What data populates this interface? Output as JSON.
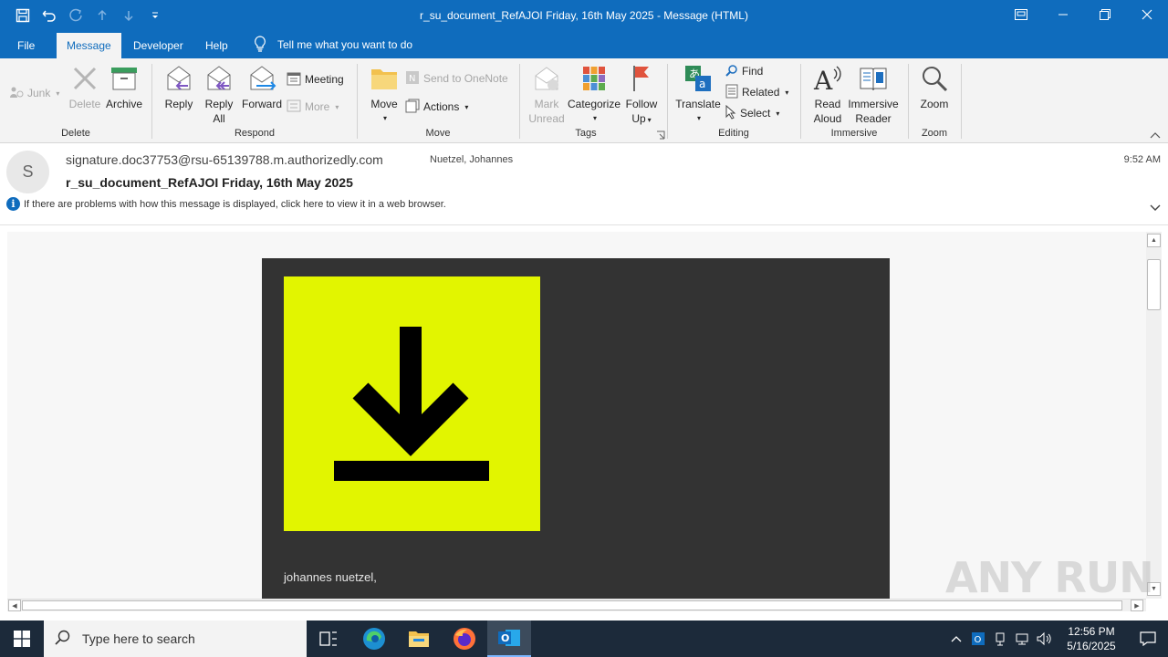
{
  "window": {
    "title": "r_su_document_RefAJOI Friday, 16th May 2025  -  Message (HTML)"
  },
  "tabs": [
    {
      "label": "File"
    },
    {
      "label": "Message"
    },
    {
      "label": "Developer"
    },
    {
      "label": "Help"
    }
  ],
  "tell_me": "Tell me what you want to do",
  "ribbon": {
    "delete": {
      "junk": "Junk",
      "delete": "Delete",
      "archive": "Archive",
      "label": "Delete"
    },
    "respond": {
      "reply": "Reply",
      "reply_all_1": "Reply",
      "reply_all_2": "All",
      "forward": "Forward",
      "meeting": "Meeting",
      "more": "More",
      "label": "Respond"
    },
    "move": {
      "move": "Move",
      "send_to_onenote": "Send to OneNote",
      "actions": "Actions",
      "label": "Move"
    },
    "tags": {
      "mark_unread_1": "Mark",
      "mark_unread_2": "Unread",
      "categorize": "Categorize",
      "follow_up_1": "Follow",
      "follow_up_2": "Up",
      "label": "Tags"
    },
    "editing": {
      "translate": "Translate",
      "find": "Find",
      "related": "Related",
      "select": "Select",
      "label": "Editing"
    },
    "immersive": {
      "read_aloud_1": "Read",
      "read_aloud_2": "Aloud",
      "immersive_reader_1": "Immersive",
      "immersive_reader_2": "Reader",
      "label": "Immersive"
    },
    "zoom": {
      "zoom": "Zoom",
      "label": "Zoom"
    }
  },
  "message": {
    "avatar_initial": "S",
    "from": "signature.doc37753@rsu-65139788.m.authorizedly.com",
    "to": "Nuetzel, Johannes",
    "subject": "r_su_document_RefAJOI Friday, 16th May 2025",
    "time": "9:52 AM",
    "info": "If there are problems with how this message is displayed, click here to view it in a web browser.",
    "greeting": "johannes nuetzel,"
  },
  "colors": {
    "accent": "#0f6cbd",
    "card_bg": "#333333",
    "download_bg": "#e2f500"
  },
  "watermark": "ANY RUN",
  "taskbar": {
    "search_placeholder": "Type here to search",
    "time": "12:56 PM",
    "date": "5/16/2025"
  }
}
